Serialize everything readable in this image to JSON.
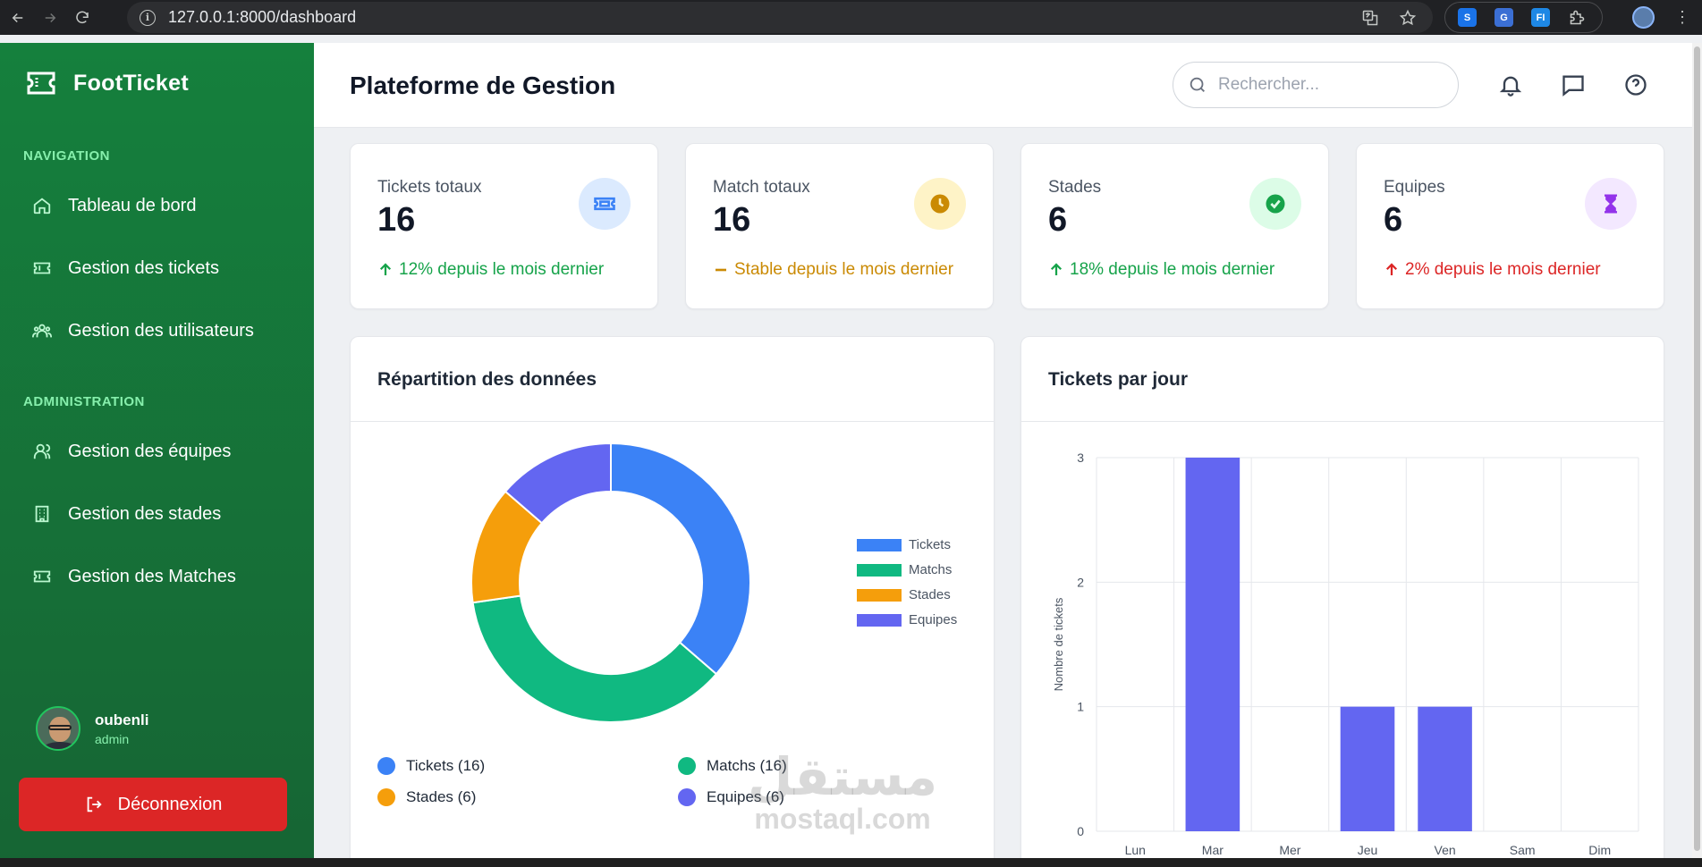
{
  "browser": {
    "url": "127.0.0.1:8000/dashboard",
    "extensions": [
      {
        "name": "s-extension-icon",
        "label": "S",
        "color": "#1a73e8"
      },
      {
        "name": "translate-extension-icon",
        "label": "G",
        "color": "#3b6fd4"
      },
      {
        "name": "fi-extension-icon",
        "label": "FI",
        "color": "#1e88e5"
      }
    ]
  },
  "sidebar": {
    "brand": "FootTicket",
    "sections": [
      {
        "title": "NAVIGATION",
        "items": [
          {
            "label": "Tableau de bord",
            "icon": "home-icon"
          },
          {
            "label": "Gestion des tickets",
            "icon": "ticket-icon"
          },
          {
            "label": "Gestion des utilisateurs",
            "icon": "users-icon"
          }
        ]
      },
      {
        "title": "ADMINISTRATION",
        "items": [
          {
            "label": "Gestion des équipes",
            "icon": "team-icon"
          },
          {
            "label": "Gestion des stades",
            "icon": "building-icon"
          },
          {
            "label": "Gestion des Matches",
            "icon": "ticket-icon"
          }
        ]
      }
    ],
    "user": {
      "name": "oubenli",
      "role": "admin"
    },
    "logout_label": "Déconnexion"
  },
  "header": {
    "title": "Plateforme de Gestion",
    "search_placeholder": "Rechercher..."
  },
  "stats": [
    {
      "label": "Tickets totaux",
      "value": "16",
      "trend": "12% depuis le mois dernier",
      "trend_dir": "up",
      "trend_color": "#16a34a",
      "icon": "ticket-icon",
      "icon_bg": "#dbeafe",
      "icon_color": "#3b82f6"
    },
    {
      "label": "Match totaux",
      "value": "16",
      "trend": "Stable depuis le mois dernier",
      "trend_dir": "flat",
      "trend_color": "#ca8a04",
      "icon": "clock-icon",
      "icon_bg": "#fef3c7",
      "icon_color": "#ca8a04"
    },
    {
      "label": "Stades",
      "value": "6",
      "trend": "18% depuis le mois dernier",
      "trend_dir": "up",
      "trend_color": "#16a34a",
      "icon": "check-circle-icon",
      "icon_bg": "#dcfce7",
      "icon_color": "#16a34a"
    },
    {
      "label": "Equipes",
      "value": "6",
      "trend": "2% depuis le mois dernier",
      "trend_dir": "up",
      "trend_color": "#dc2626",
      "icon": "hourglass-icon",
      "icon_bg": "#f3e8ff",
      "icon_color": "#9333ea"
    }
  ],
  "panels": {
    "donut_title": "Répartition des données",
    "bar_title": "Tickets par jour"
  },
  "chart_data": [
    {
      "type": "pie",
      "categories": [
        "Tickets",
        "Matchs",
        "Stades",
        "Equipes"
      ],
      "values": [
        16,
        16,
        6,
        6
      ],
      "colors": [
        "#3b82f6",
        "#10b981",
        "#f59e0b",
        "#6366f1"
      ],
      "legend": "right",
      "summary_labels": [
        "Tickets (16)",
        "Matchs (16)",
        "Stades (6)",
        "Equipes (6)"
      ]
    },
    {
      "type": "bar",
      "categories": [
        "Lun",
        "Mar",
        "Mer",
        "Jeu",
        "Ven",
        "Sam",
        "Dim"
      ],
      "values": [
        0,
        3,
        0,
        1,
        1,
        0,
        0
      ],
      "color": "#6366f1",
      "ylabel": "Nombre de tickets",
      "ylim": [
        0,
        3
      ],
      "yticks": [
        0,
        1,
        2,
        3
      ],
      "grid": true
    }
  ],
  "watermark": {
    "arabic": "مستقل",
    "latin": "mostaql.com"
  }
}
